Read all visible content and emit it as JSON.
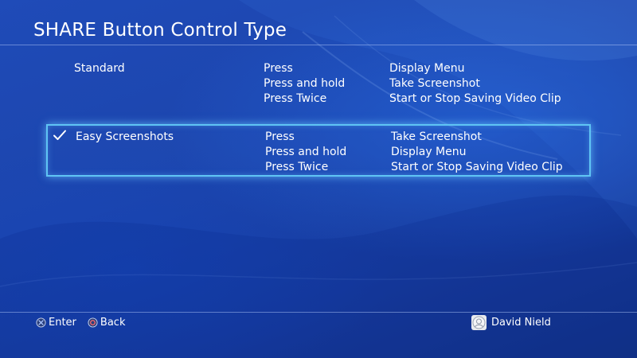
{
  "title": "SHARE Button Control Type",
  "options": [
    {
      "name": "Standard",
      "selected": false,
      "rows": [
        {
          "action": "Press",
          "result": "Display Menu"
        },
        {
          "action": "Press and hold",
          "result": "Take Screenshot"
        },
        {
          "action": "Press Twice",
          "result": "Start or Stop Saving Video Clip"
        }
      ]
    },
    {
      "name": "Easy Screenshots",
      "selected": true,
      "rows": [
        {
          "action": "Press",
          "result": "Take Screenshot"
        },
        {
          "action": "Press and hold",
          "result": "Display Menu"
        },
        {
          "action": "Press Twice",
          "result": "Start or Stop Saving Video Clip"
        }
      ]
    }
  ],
  "footer": {
    "enter_label": "Enter",
    "back_label": "Back",
    "enter_icon": "cross-button-icon",
    "back_icon": "circle-button-icon"
  },
  "user": {
    "name": "David Nield",
    "avatar_icon": "avatar-icon"
  },
  "colors": {
    "background": "#1c45ad",
    "focus_border": "#5fc4f4",
    "text": "#ffffff"
  }
}
